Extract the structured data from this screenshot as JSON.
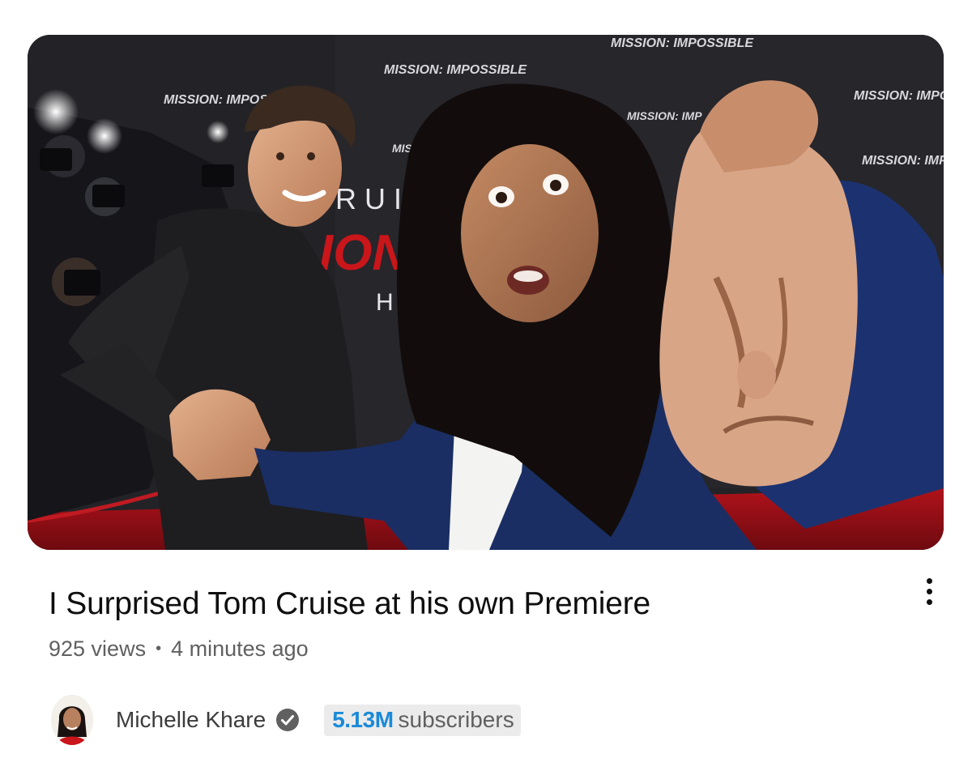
{
  "video": {
    "title": "I Surprised Tom Cruise at his own Premiere",
    "views": "925 views",
    "separator": "•",
    "published": "4 minutes ago"
  },
  "thumbnail": {
    "backdrop_texts": [
      "TOM CRUISE",
      "MISSION: IMPOSSIBLE",
      "THE FINAL RECKONING"
    ],
    "accent_color": "#c8161b"
  },
  "channel": {
    "name": "Michelle Khare",
    "verified_icon": "verified-check-icon",
    "subscriber_count": "5.13M",
    "subscriber_label": "subscribers",
    "count_color": "#1a8ad8"
  },
  "actions": {
    "more_icon": "more-vert-icon"
  }
}
